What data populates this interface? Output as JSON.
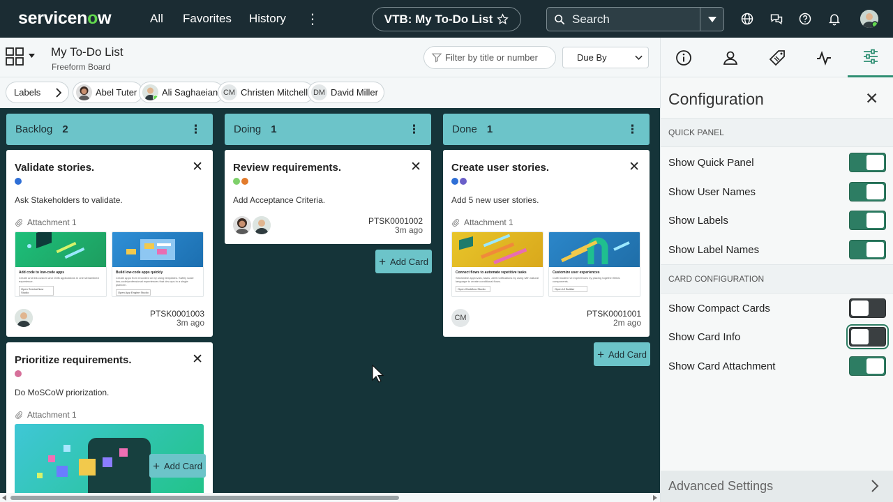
{
  "nav": {
    "logo_a": "servicen",
    "logo_o": "o",
    "logo_b": "w",
    "all": "All",
    "favorites": "Favorites",
    "history": "History",
    "more": "⋮",
    "workspace_pill": "VTB: My To-Do List",
    "search_placeholder": "Search",
    "icons": [
      "globe-icon",
      "chat-icon",
      "help-icon",
      "bell-icon",
      "user-avatar"
    ]
  },
  "board": {
    "title": "My To-Do List",
    "subtitle": "Freeform Board",
    "filter_placeholder": "Filter by title or number",
    "sort_value": "Due By",
    "labels_chip": "Labels",
    "people": [
      {
        "name": "Abel Tuter",
        "initials": ""
      },
      {
        "name": "Ali Saghaeian",
        "initials": ""
      },
      {
        "name": "Christen Mitchell",
        "initials": "CM"
      },
      {
        "name": "David Miller",
        "initials": "DM"
      }
    ],
    "columns": [
      {
        "name": "Backlog",
        "count": "2"
      },
      {
        "name": "Doing",
        "count": "1"
      },
      {
        "name": "Done",
        "count": "1"
      }
    ],
    "add_card": "Add Card",
    "cards": {
      "validate": {
        "title": "Validate stories.",
        "desc": "Ask Stakeholders to validate.",
        "attachment": "Attachment 1",
        "number": "PTSK0001003",
        "age": "3m ago",
        "dot_colors": [
          "#2f6fd6"
        ],
        "thumbs": [
          {
            "title": "Add code to low-code apps",
            "desc": "Create and link custom and OOB applications in one streamlined experience.",
            "btn": "Open ServiceNow Studio"
          },
          {
            "title": "Build low-code apps quickly",
            "desc": "Create apps from recorded on by using templates. Safely scale low-code/professional experiences that dev-ops in a single platform.",
            "btn": "Open App Engine Studio"
          }
        ]
      },
      "review": {
        "title": "Review requirements.",
        "desc": "Add Acceptance Criteria.",
        "number": "PTSK0001002",
        "age": "3m ago",
        "dot_colors": [
          "#7ed06a",
          "#e27b2c"
        ]
      },
      "create": {
        "title": "Create user stories.",
        "desc": "Add 5 new user stories.",
        "attachment": "Attachment 1",
        "number": "PTSK0001001",
        "age": "2m ago",
        "avatar_initials": "CM",
        "dot_colors": [
          "#2f6fd6",
          "#6a5fc9"
        ],
        "thumbs": [
          {
            "title": "Connect flows to automate repetitive tasks",
            "desc": "Streamline approvals, tasks, alert notifications by using with natural language to create conditional flows.",
            "btn": "Open Workflow Studio"
          },
          {
            "title": "Customize user experiences",
            "desc": "Craft modern UI experiences by placing together fields components.",
            "btn": "Open UI Builder"
          }
        ]
      },
      "prioritize": {
        "title": "Prioritize requirements.",
        "desc": "Do MoSCoW priorization.",
        "attachment": "Attachment 1",
        "dot_colors": [
          "#d6709a"
        ]
      }
    }
  },
  "panel": {
    "tabs": [
      "info-icon",
      "user-icon",
      "tag-icon",
      "activity-icon",
      "settings-sliders-icon"
    ],
    "title": "Configuration",
    "section_quick": "QUICK PANEL",
    "section_card": "CARD CONFIGURATION",
    "toggles": [
      {
        "label": "Show Quick Panel",
        "on": true
      },
      {
        "label": "Show User Names",
        "on": true
      },
      {
        "label": "Show Labels",
        "on": true
      },
      {
        "label": "Show Label Names",
        "on": true
      },
      {
        "label": "Show Compact Cards",
        "on": false
      },
      {
        "label": "Show Card Info",
        "on": false
      },
      {
        "label": "Show Card Attachment",
        "on": true
      }
    ],
    "advanced": "Advanced Settings"
  },
  "colors": {
    "nav_bg": "#1b2c33",
    "board_bg": "#153439",
    "column_header": "#6cc4c9",
    "toggle_on": "#2d7d63",
    "logo_accent": "#62d84e"
  }
}
